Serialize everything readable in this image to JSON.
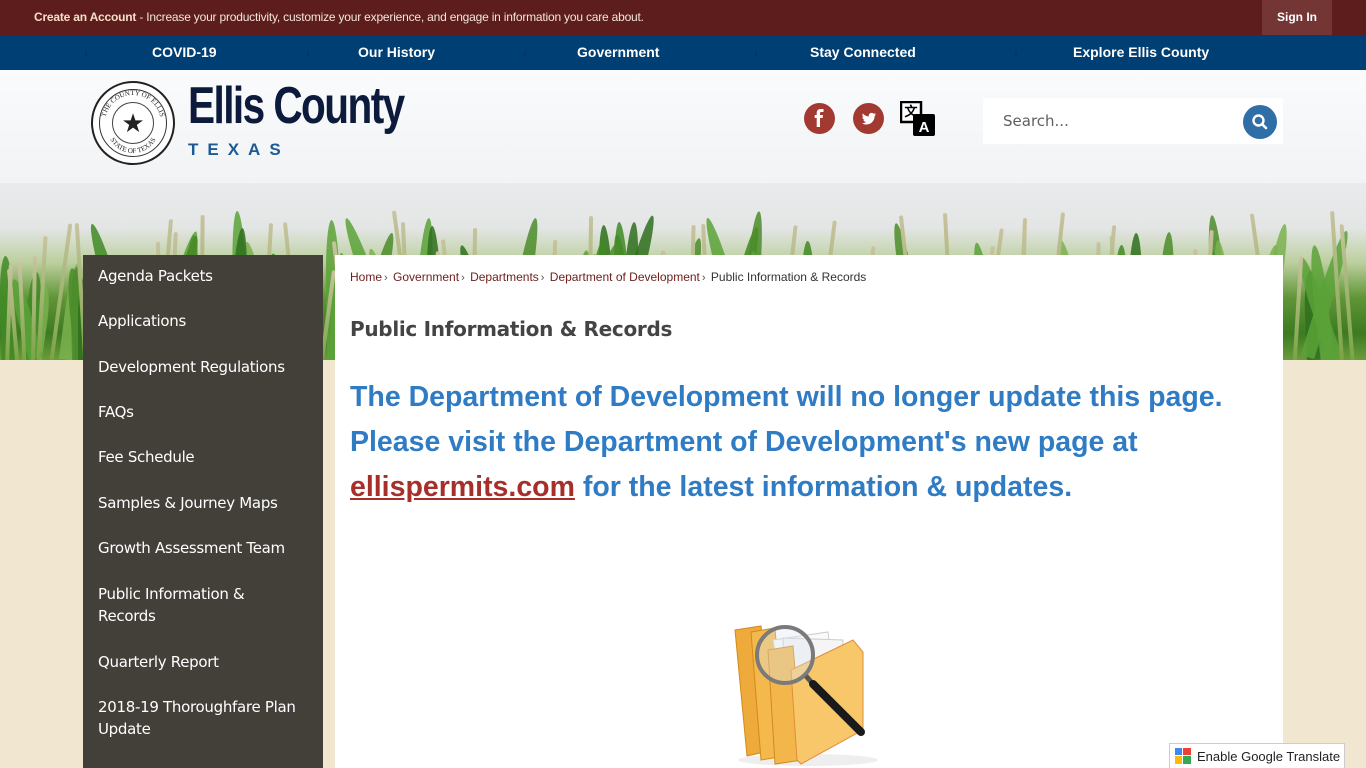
{
  "topbar": {
    "create_account_label": "Create an Account",
    "create_account_message": " - Increase your productivity, customize your experience, and engage in information you care about.",
    "sign_in_label": "Sign In"
  },
  "main_nav": {
    "items": [
      {
        "label": "COVID-19"
      },
      {
        "label": "Our History"
      },
      {
        "label": "Government"
      },
      {
        "label": "Stay Connected"
      },
      {
        "label": "Explore Ellis County"
      }
    ]
  },
  "header": {
    "site_name": "Ellis County",
    "site_subtitle": "TEXAS",
    "seal_text_top": "THE COUNTY OF ELLIS",
    "seal_text_bottom": "STATE OF TEXAS",
    "social": [
      {
        "name": "facebook",
        "glyph": "f"
      },
      {
        "name": "twitter",
        "glyph": "t"
      }
    ],
    "search": {
      "placeholder": "Search...",
      "value": ""
    }
  },
  "sidebar": {
    "items": [
      {
        "label": "Agenda Packets"
      },
      {
        "label": "Applications"
      },
      {
        "label": "Development Regulations"
      },
      {
        "label": "FAQs"
      },
      {
        "label": "Fee Schedule"
      },
      {
        "label": "Samples & Journey Maps"
      },
      {
        "label": "Growth Assessment Team"
      },
      {
        "label": "Public Information & Records"
      },
      {
        "label": "Quarterly Report"
      },
      {
        "label": "2018-19 Thoroughfare Plan Update"
      }
    ]
  },
  "content": {
    "breadcrumb": [
      {
        "label": "Home"
      },
      {
        "label": "Government"
      },
      {
        "label": "Departments"
      },
      {
        "label": "Department of Development"
      },
      {
        "label": "Public Information & Records"
      }
    ],
    "page_title": "Public Information & Records",
    "notice_before": "The Department of Development will no longer update this page. Please visit the Department of Development's new page at ",
    "notice_link": "ellispermits.com",
    "notice_after": " for the latest information & updates.",
    "image_alt": "Folders with magnifying glass"
  },
  "google_translate": {
    "label": "Enable Google Translate"
  },
  "colors": {
    "topbar_bg": "#5c1d1c",
    "nav_bg": "#003f74",
    "sidebar_bg": "#433f39",
    "notice_text": "#2f7bc4",
    "link_red": "#a72f2a",
    "social_red": "#a33a31",
    "search_blue": "#2f6ea6"
  }
}
